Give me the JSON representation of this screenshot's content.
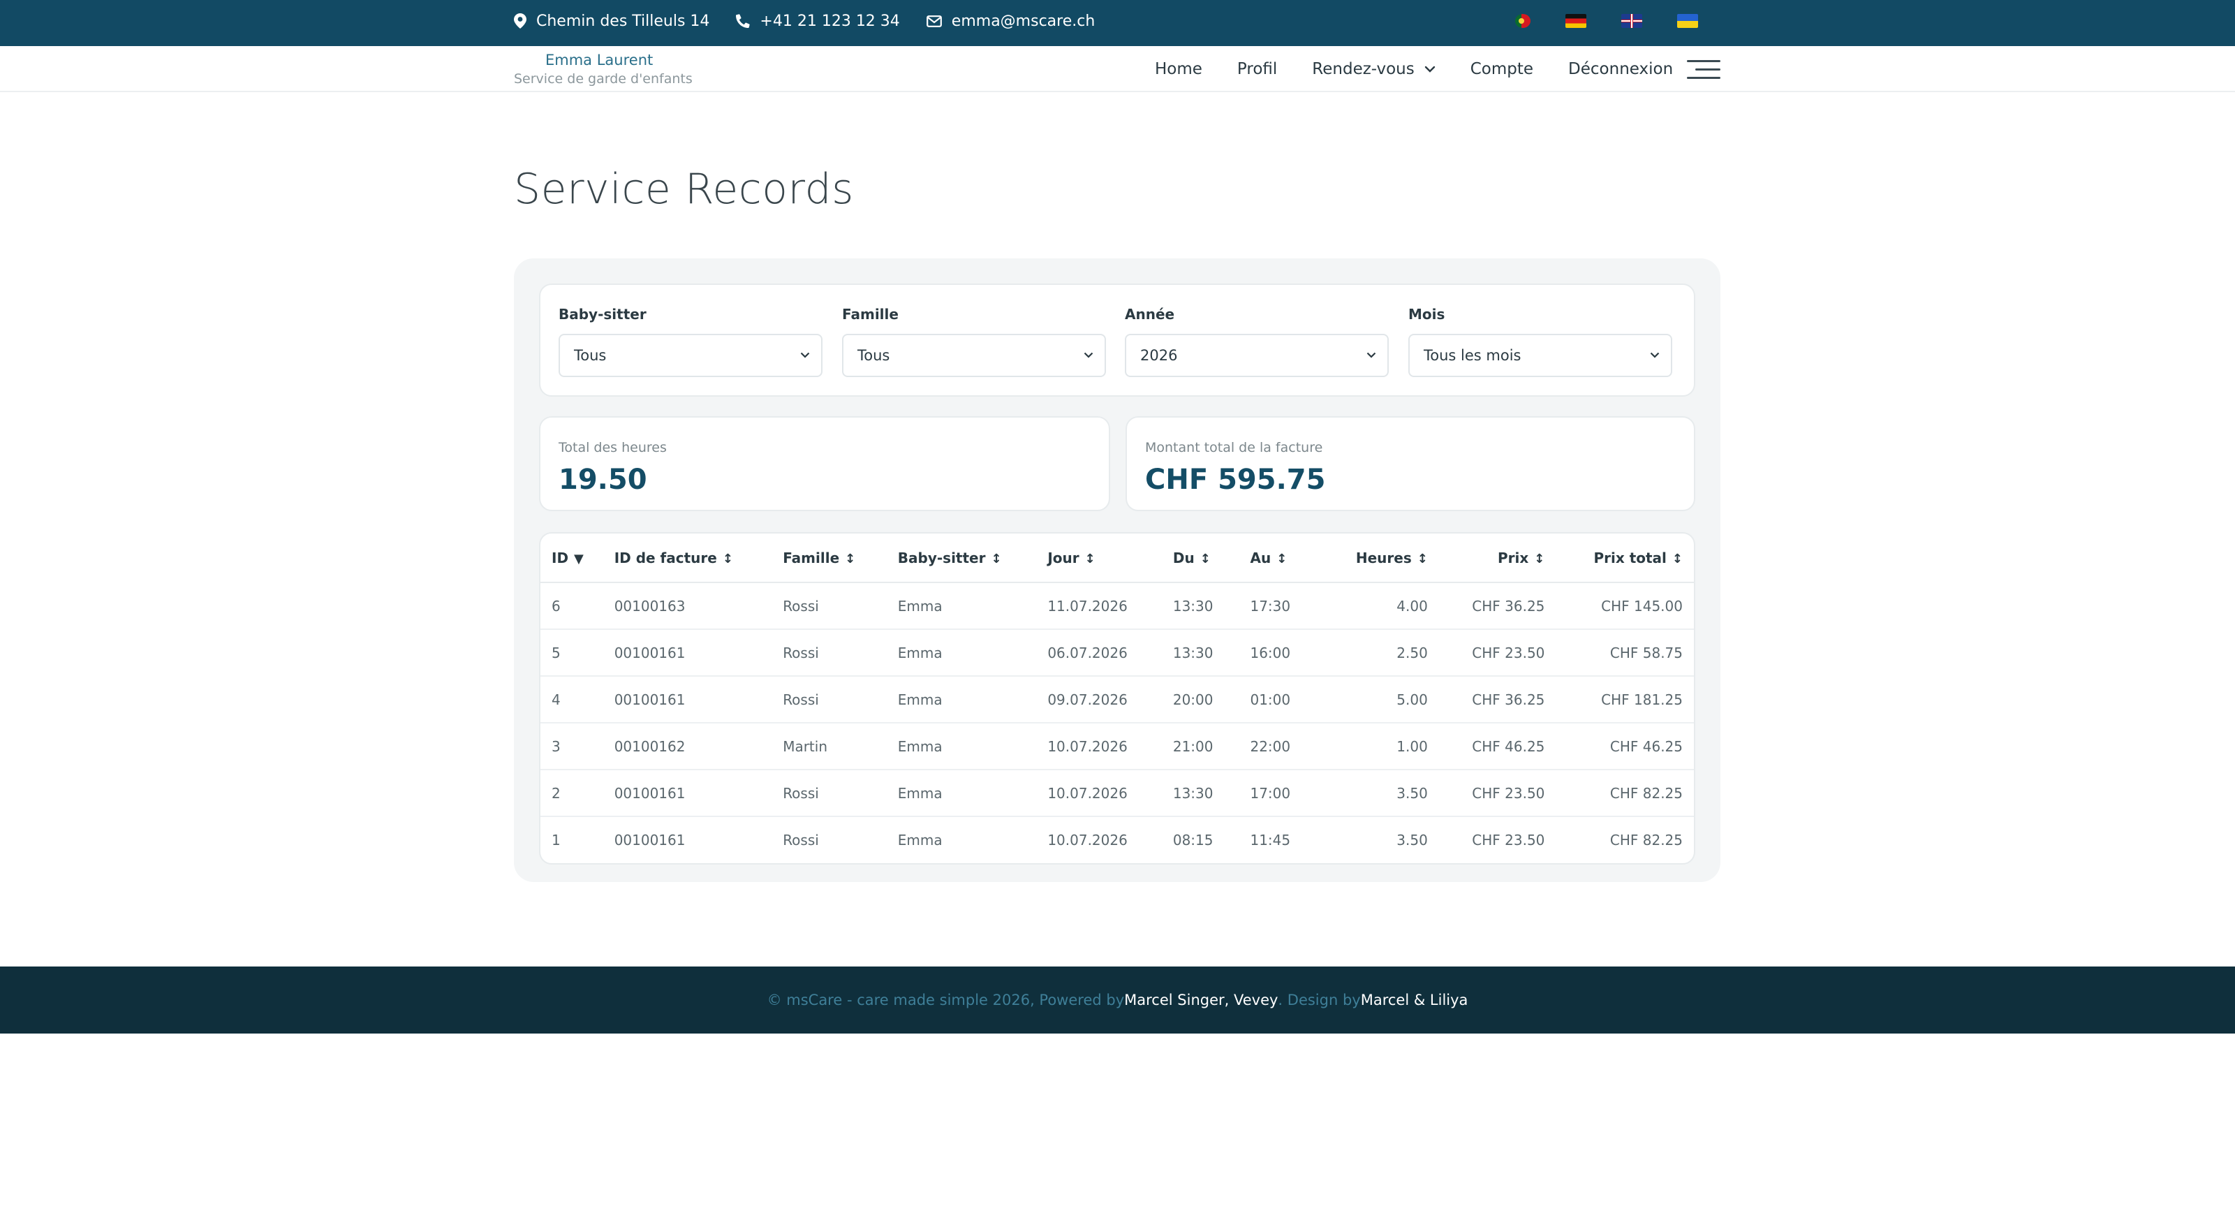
{
  "topbar": {
    "address": "Chemin des Tilleuls 14",
    "phone": "+41 21 123 12 34",
    "email": "emma@mscare.ch",
    "flags": [
      "pt",
      "de",
      "gb",
      "ua"
    ]
  },
  "brand": {
    "name": "Emma Laurent",
    "tagline": "Service de garde d'enfants"
  },
  "nav": {
    "home": "Home",
    "profile": "Profil",
    "appointments": "Rendez-vous",
    "account": "Compte",
    "logout": "Déconnexion"
  },
  "page": {
    "title": "Service Records"
  },
  "filters": {
    "babysitter": {
      "label": "Baby-sitter",
      "value": "Tous"
    },
    "family": {
      "label": "Famille",
      "value": "Tous"
    },
    "year": {
      "label": "Année",
      "value": "2026"
    },
    "month": {
      "label": "Mois",
      "value": "Tous les mois"
    }
  },
  "stats": {
    "hours": {
      "label": "Total des heures",
      "value": "19.50"
    },
    "amount": {
      "label": "Montant total de la facture",
      "value": "CHF 595.75"
    }
  },
  "table": {
    "headers": {
      "id": "ID",
      "invoice": "ID de facture",
      "family": "Famille",
      "babysitter": "Baby-sitter",
      "day": "Jour",
      "from": "Du",
      "to": "Au",
      "hours": "Heures",
      "price": "Prix",
      "total": "Prix total"
    },
    "sort_active": "▼",
    "sort_idle": "↕",
    "rows": [
      {
        "id": "6",
        "invoice": "00100163",
        "family": "Rossi",
        "babysitter": "Emma",
        "day": "11.07.2026",
        "from": "13:30",
        "to": "17:30",
        "hours": "4.00",
        "price": "CHF 36.25",
        "total": "CHF 145.00"
      },
      {
        "id": "5",
        "invoice": "00100161",
        "family": "Rossi",
        "babysitter": "Emma",
        "day": "06.07.2026",
        "from": "13:30",
        "to": "16:00",
        "hours": "2.50",
        "price": "CHF 23.50",
        "total": "CHF 58.75"
      },
      {
        "id": "4",
        "invoice": "00100161",
        "family": "Rossi",
        "babysitter": "Emma",
        "day": "09.07.2026",
        "from": "20:00",
        "to": "01:00",
        "hours": "5.00",
        "price": "CHF 36.25",
        "total": "CHF 181.25"
      },
      {
        "id": "3",
        "invoice": "00100162",
        "family": "Martin",
        "babysitter": "Emma",
        "day": "10.07.2026",
        "from": "21:00",
        "to": "22:00",
        "hours": "1.00",
        "price": "CHF 46.25",
        "total": "CHF 46.25"
      },
      {
        "id": "2",
        "invoice": "00100161",
        "family": "Rossi",
        "babysitter": "Emma",
        "day": "10.07.2026",
        "from": "13:30",
        "to": "17:00",
        "hours": "3.50",
        "price": "CHF 23.50",
        "total": "CHF 82.25"
      },
      {
        "id": "1",
        "invoice": "00100161",
        "family": "Rossi",
        "babysitter": "Emma",
        "day": "10.07.2026",
        "from": "08:15",
        "to": "11:45",
        "hours": "3.50",
        "price": "CHF 23.50",
        "total": "CHF 82.25"
      }
    ]
  },
  "footer": {
    "copyright": "© msCare - care made simple 2026, Powered by ",
    "powered_by": "Marcel Singer, Vevey",
    "design_prefix": ". Design by ",
    "designer": "Marcel & Liliya"
  }
}
